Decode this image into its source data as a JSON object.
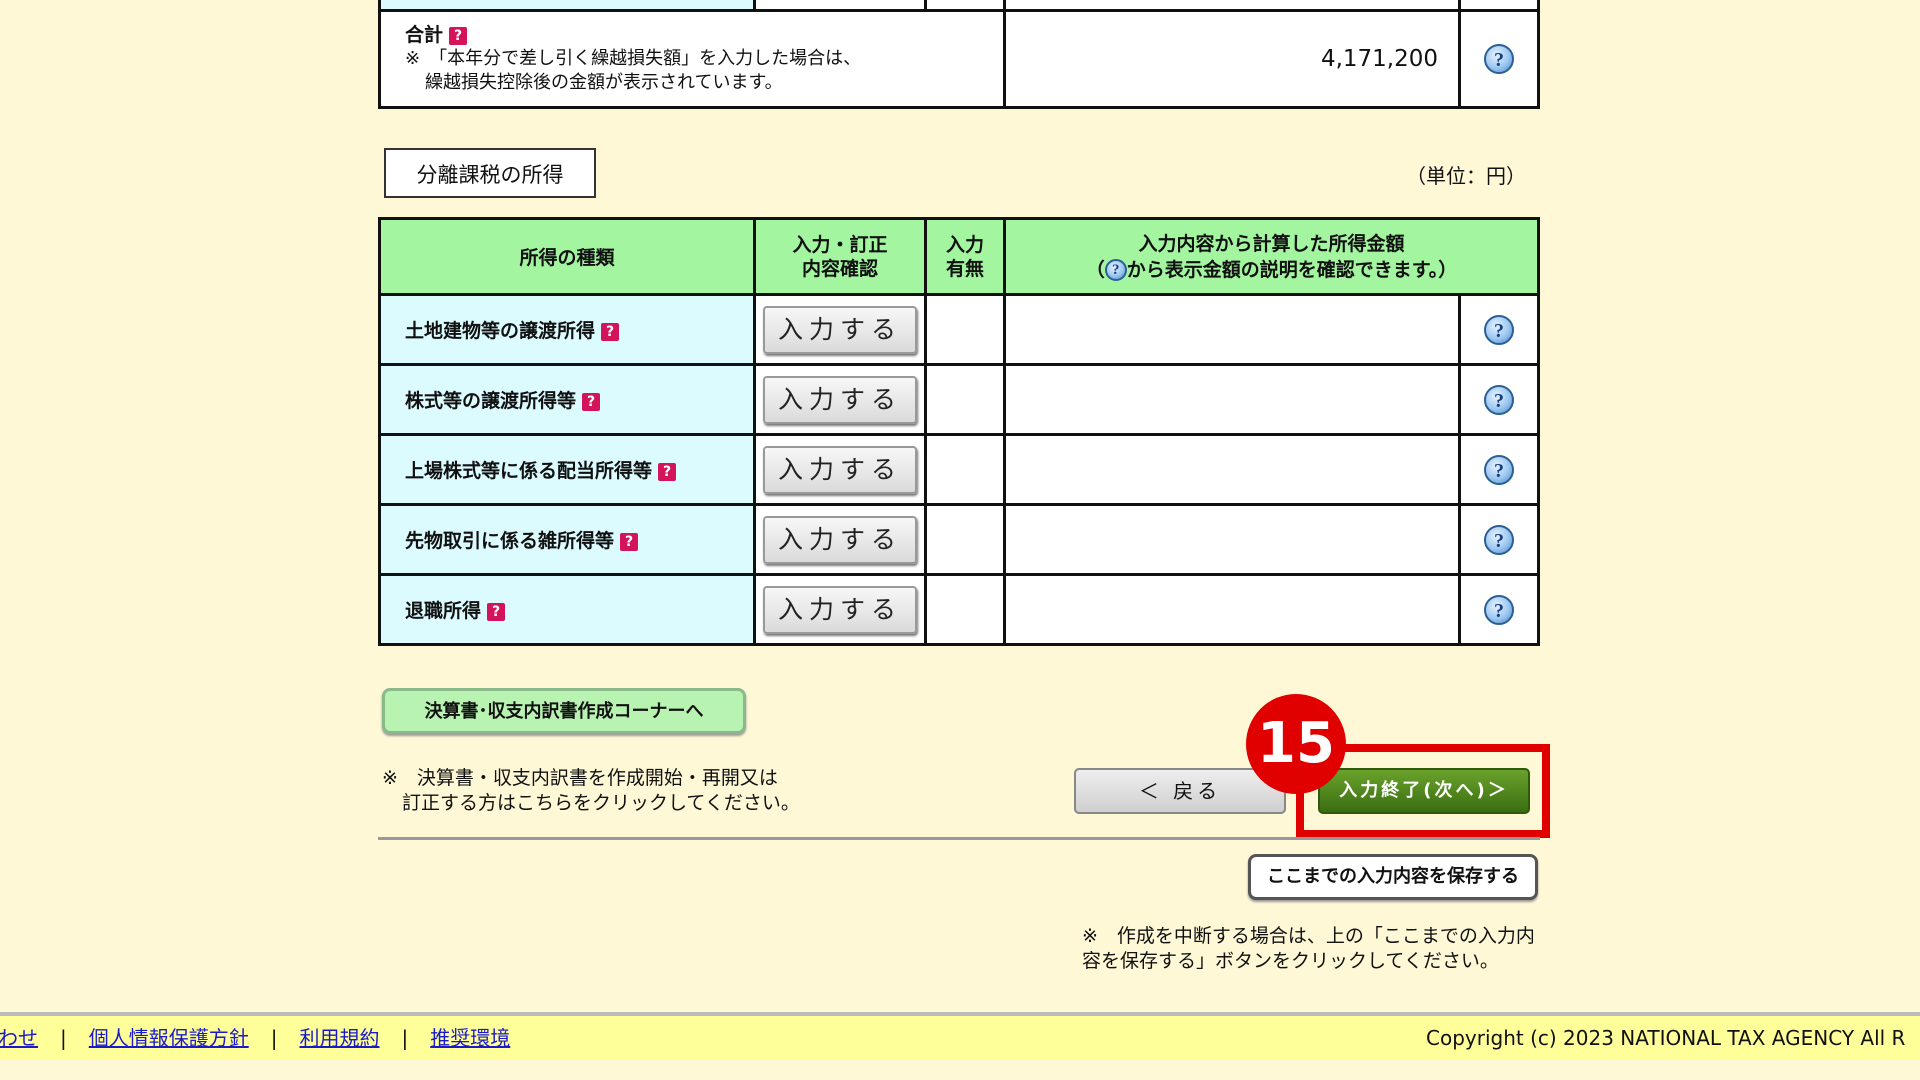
{
  "summary": {
    "total_label": "合計",
    "note_line1": "※　「本年分で差し引く繰越損失額」を入力した場合は、",
    "note_line2": "繰越損失控除後の金額が表示されています。",
    "total_value": "4,171,200"
  },
  "separate": {
    "section_label": "分離課税の所得",
    "unit_label": "（単位：円）",
    "headers": {
      "type": "所得の種類",
      "input_line1": "入力・訂正",
      "input_line2": "内容確認",
      "has_line1": "入力",
      "has_line2": "有無",
      "amount_line1": "入力内容から計算した所得金額",
      "amount_line2_pre": "（",
      "amount_line2_post": "から表示金額の説明を確認できます。）"
    },
    "rows": [
      {
        "label": "土地建物等の譲渡所得",
        "button": "入力する",
        "status": "",
        "amount": ""
      },
      {
        "label": "株式等の譲渡所得等",
        "button": "入力する",
        "status": "",
        "amount": ""
      },
      {
        "label": "上場株式等に係る配当所得等",
        "button": "入力する",
        "status": "",
        "amount": ""
      },
      {
        "label": "先物取引に係る雑所得等",
        "button": "入力する",
        "status": "",
        "amount": ""
      },
      {
        "label": "退職所得",
        "button": "入力する",
        "status": "",
        "amount": ""
      }
    ]
  },
  "actions": {
    "corner_button": "決算書･収支内訳書作成コーナーへ",
    "corner_note_line1": "※　決算書・収支内訳書を作成開始・再開又は",
    "corner_note_line2": "訂正する方はこちらをクリックしてください。",
    "back_button": "＜ 戻る",
    "next_button": "入力終了(次へ)＞",
    "step_number": "15",
    "save_button": "ここまでの入力内容を保存する",
    "save_note": "※　作成を中断する場合は、上の「ここまでの入力内容を保存する」ボタンをクリックしてください。"
  },
  "icons": {
    "help": "question-bubble-icon",
    "term": "red-question-icon"
  },
  "colors": {
    "header_green": "#a3f5a0",
    "row_cyan": "#dcfbff",
    "highlight_red": "#e10000",
    "page_bg": "#fff8d6"
  },
  "footer": {
    "link_partial": "わせ",
    "link_privacy": "個人情報保護方針",
    "link_terms": "利用規約",
    "link_env": "推奨環境",
    "separator": "|",
    "copyright": "Copyright (c) 2023 NATIONAL TAX AGENCY All R"
  }
}
